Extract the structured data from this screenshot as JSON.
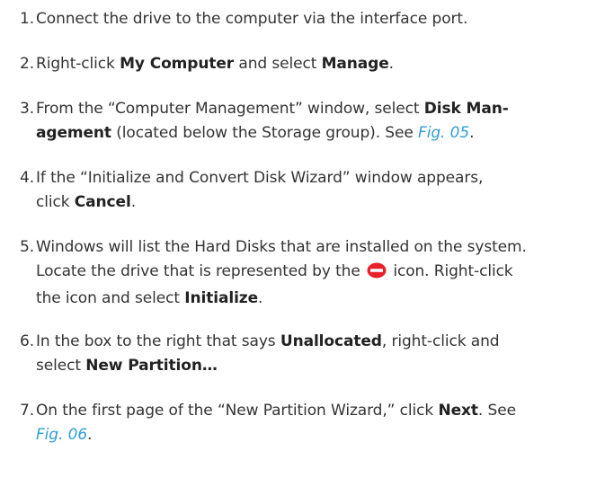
{
  "steps": [
    {
      "number": "1.",
      "text": "Connect the drive to the computer via the interface port."
    },
    {
      "number": "2.",
      "pre": "Right-click ",
      "bold1": "My Computer",
      "mid": " and select ",
      "bold2": "Manage",
      "post": "."
    },
    {
      "number": "3.",
      "pre": "From the “Computer Management” window, select ",
      "bold1a": "Disk Man-",
      "bold1b": "agement",
      "mid": " (located below the Storage group). See ",
      "ref": "Fig. 05",
      "post": "."
    },
    {
      "number": "4.",
      "pre": "If the “Initialize and Convert Disk Wizard” window appears,",
      "pre2": "click ",
      "bold": "Cancel",
      "post": "."
    },
    {
      "number": "5.",
      "line1": "Windows will list the Hard Disks that are installed on the system.",
      "pre": "Locate the drive that is represented by the ",
      "icon": "uninitialized-disk-icon",
      "mid": " icon. Right-click",
      "pre2": "the icon and select ",
      "bold": "Initialize",
      "post": "."
    },
    {
      "number": "6.",
      "pre": "In the box to the right that says ",
      "bold1": "Unallocated",
      "mid": ", right-click and",
      "pre2": "select ",
      "bold2": "New Partition…"
    },
    {
      "number": "7.",
      "pre": "On the first page of the “New Partition Wizard,” click ",
      "bold": "Next",
      "mid": ". See",
      "ref": "Fig. 06",
      "post": "."
    }
  ],
  "colors": {
    "text": "#333333",
    "link": "#2f9ed6",
    "icon_red": "#e8202a"
  }
}
